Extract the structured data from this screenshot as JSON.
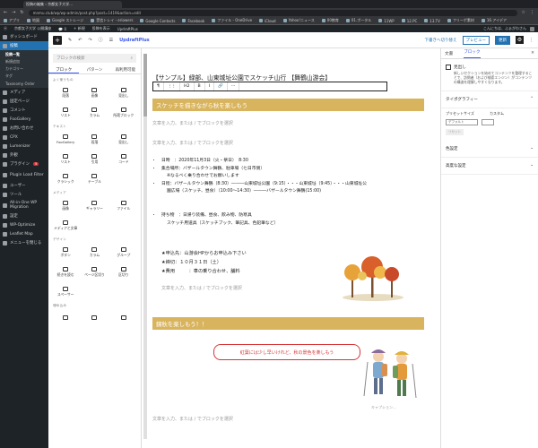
{
  "browser": {
    "tab_title": "投稿の編集 ‹ 京都女子大学…",
    "url": "mnmu.club/wp/wp-admin/post.php?post=1419&action=edit",
    "bookmarks": [
      "アプリ",
      "地図",
      "Google ストレージ",
      "受信トレイ - eriowers",
      "Google Contacts",
      "Facebook",
      "ファイル - OneDrive",
      "iCloud",
      "Yahoo!ニュース",
      "00教育",
      "01.ポータル",
      "11WP",
      "12.PC",
      "13.TV",
      "フリーポ素材",
      "16.アイデア"
    ]
  },
  "adminbar": {
    "site": "京都女子大学 公開講座",
    "comments": "0",
    "new": "+ 新規",
    "view": "投稿を表示",
    "updraft": "UpdraftPlus",
    "greeting": "こんにちは、ふぁがわさん"
  },
  "sidebar": {
    "items": [
      {
        "label": "ダッシュボード",
        "icon": "dashboard-icon"
      },
      {
        "label": "投稿",
        "icon": "pin-icon",
        "active": true
      },
      {
        "label": "メディア",
        "icon": "media-icon"
      },
      {
        "label": "固定ページ",
        "icon": "page-icon"
      },
      {
        "label": "コメント",
        "icon": "comment-icon"
      },
      {
        "label": "FooGallery",
        "icon": "gallery-icon"
      },
      {
        "label": "お問い合わせ",
        "icon": "mail-icon"
      },
      {
        "label": "CPX",
        "icon": "cpx-icon"
      },
      {
        "label": "Lumenizer",
        "icon": "lumen-icon"
      },
      {
        "label": "外観",
        "icon": "brush-icon"
      },
      {
        "label": "プラグイン",
        "icon": "plugin-icon",
        "badge": "5"
      },
      {
        "label": "Plugin Load Filter",
        "icon": "filter-icon"
      },
      {
        "label": "ユーザー",
        "icon": "user-icon"
      },
      {
        "label": "ツール",
        "icon": "tool-icon"
      },
      {
        "label": "All-in-One WP Migration",
        "icon": "migration-icon"
      },
      {
        "label": "設定",
        "icon": "settings-icon"
      },
      {
        "label": "WP-Optimize",
        "icon": "optimize-icon"
      },
      {
        "label": "Leaflet Map",
        "icon": "map-icon"
      },
      {
        "label": "メニューを閉じる",
        "icon": "collapse-icon"
      }
    ],
    "sub": [
      "投稿一覧",
      "新規追加",
      "カテゴリー",
      "タグ",
      "Taxonomy Order"
    ]
  },
  "toolbar": {
    "draft_switch": "下書きへ切り替え",
    "preview": "プレビュー",
    "update": "更新",
    "updraft": "UpdraftPlus"
  },
  "inserter": {
    "search_placeholder": "ブロックの検索",
    "tabs": [
      "ブロック",
      "パターン",
      "再利用可能"
    ],
    "categories": [
      {
        "name": "よく使うもの",
        "blocks": [
          "段落",
          "画像",
          "見出し",
          "リスト",
          "カラム",
          "所蔵ブロック"
        ]
      },
      {
        "name": "テキスト",
        "blocks": [
          "FooGallery",
          "段落",
          "見出し",
          "リスト",
          "引用",
          "コード",
          "クラシック",
          "テーブル"
        ]
      },
      {
        "name": "メディア",
        "blocks": [
          "画像",
          "ギャラリー",
          "ファイル",
          "メディアと文章"
        ]
      },
      {
        "name": "デザイン",
        "blocks": [
          "ボタン",
          "カラム",
          "グループ",
          "続きを読む",
          "ページ区切り",
          "区切り",
          "スペーサー"
        ]
      },
      {
        "name": "埋め込み",
        "blocks": [
          "",
          "",
          ""
        ]
      }
    ]
  },
  "editor": {
    "post_title": "【サンプル】緑部、山東城址公園でスケッチ山行 【舞鶴山游会】",
    "block_toolbar": [
      "¶",
      "⋮⋮",
      "H2",
      "B",
      "I",
      "🔗",
      "⋯"
    ],
    "heading1": "スケッチを描きながら秋を楽しもう",
    "placeholder": "文章を入力、または / でブロックを選択",
    "list": [
      "日時　：2020年11月3日（火・祭日）　8:30",
      "集合場所：バザールタウン舞鶴、駐車場（七日市側）",
      "※なるべく乗り合わせでお願いします",
      "日程：バザールタウン舞鶴（8:30）―――山東城址公園（9:15）・・・山東城址（9:45）・・・山東城址公",
      "園広場（スケッチ、昼食）（10:00〜14:30）―――バザールタウン舞鶴(15:00)",
      "持ち物　：日帰り装備、昼食、飲み物、防寒具",
      "スケッチ用道具（スケッチブック、筆記具、色鉛筆など）"
    ],
    "apply": [
      "★申込先：山游会HPからお申込み下さい",
      "★締切：１０月３１日（土）",
      "★費用　　　：車の乗り合わせ、舗料"
    ],
    "heading2": "錦秋を楽しもう！！",
    "bubble": "紅葉には少し早いけれど、秋の景色を楽しもう",
    "caption": "キャプション..."
  },
  "settings": {
    "tabs": [
      "文書",
      "ブロック"
    ],
    "block_name": "見出し",
    "block_desc": "新しいセクションを始めてコンテンツを整理することで、訪問者（および検索エンジン）がコンテンツの構造を理解しやすくなります。",
    "panels": [
      "タイポグラフィー",
      "色設定",
      "高度な設定"
    ],
    "preset_label": "プリセットサイズ",
    "custom_label": "カスタム",
    "preset_value": "デフォルト",
    "reset": "リセット"
  },
  "colors": {
    "admin_dark": "#1d2327",
    "accent": "#2271b1",
    "heading_bg": "#d9b45e",
    "bubble_red": "#d63638"
  }
}
